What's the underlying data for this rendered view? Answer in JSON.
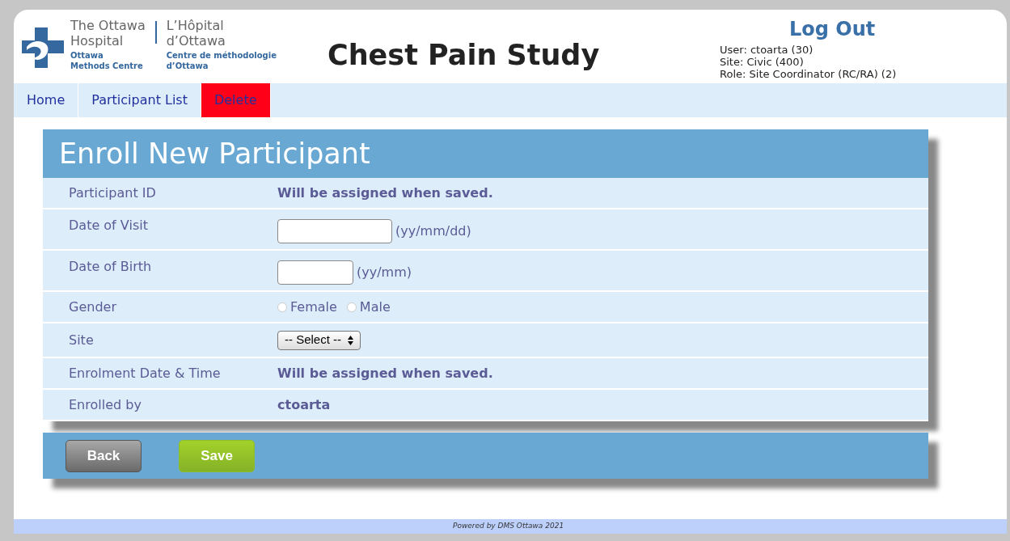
{
  "logo": {
    "name_en": [
      "The Ottawa",
      "Hospital"
    ],
    "sub_en": [
      "Ottawa",
      "Methods Centre"
    ],
    "name_fr": [
      "L’Hôpital",
      "d’Ottawa"
    ],
    "sub_fr": [
      "Centre de méthodologie",
      "d’Ottawa"
    ]
  },
  "app_title": "Chest Pain Study",
  "logout": "Log Out",
  "user_info": [
    "User: ctoarta (30)",
    "Site: Civic (400)",
    "Role: Site Coordinator (RC/RA) (2)"
  ],
  "nav": [
    {
      "label": "Home",
      "kind": "link"
    },
    {
      "label": "Participant List",
      "kind": "link"
    },
    {
      "label": "Delete",
      "kind": "danger"
    }
  ],
  "form": {
    "title": "Enroll New Participant",
    "rows": [
      {
        "label": "Participant ID",
        "kind": "static",
        "value": "Will be assigned when saved."
      },
      {
        "label": "Date of Visit",
        "kind": "date",
        "hint": "(yy/mm/dd)",
        "wide": true
      },
      {
        "label": "Date of Birth",
        "kind": "date",
        "hint": "(yy/mm)",
        "wide": false
      },
      {
        "label": "Gender",
        "kind": "radio",
        "options": [
          {
            "label": "Female",
            "selected": false
          },
          {
            "label": "Male",
            "selected": false
          }
        ]
      },
      {
        "label": "Site",
        "kind": "select",
        "value": "-- Select --"
      },
      {
        "label": "Enrolment Date & Time",
        "kind": "static",
        "value": "Will be assigned when saved."
      },
      {
        "label": "Enrolled by",
        "kind": "static",
        "value": "ctoarta"
      }
    ]
  },
  "buttons": [
    {
      "label": "Back",
      "kind": "secondary"
    },
    {
      "label": "Save",
      "kind": "primary"
    }
  ],
  "footer": "Powered by DMS Ottawa 2021"
}
